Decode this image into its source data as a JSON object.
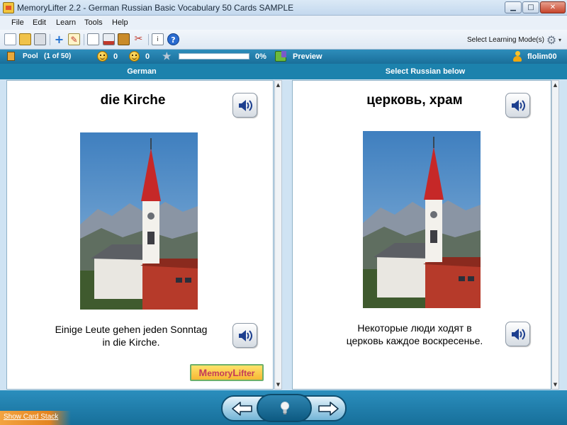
{
  "window": {
    "title": "MemoryLifter 2.2 - German Russian Basic Vocabulary 50 Cards SAMPLE",
    "min_glyph": "▁",
    "max_glyph": "□",
    "close_glyph": "✕"
  },
  "menu": [
    "File",
    "Edit",
    "Learn",
    "Tools",
    "Help"
  ],
  "toolbar": {
    "learning_mode_label": "Select Learning Mode(s)",
    "buttons": [
      "new-icon",
      "open-icon",
      "print-icon",
      "add-card-icon",
      "edit-icon",
      "presentation-icon",
      "statistics-icon",
      "archive-icon",
      "tools-icon",
      "info-icon",
      "help-icon"
    ]
  },
  "status": {
    "pool_label": "Pool",
    "pool_count": "(1 of 50)",
    "right_count": "0",
    "wrong_count": "0",
    "progress_value": 0,
    "progress_text": "0%",
    "preview_label": "Preview",
    "user_name": "flolim00"
  },
  "headers": {
    "left": "German",
    "right": "Select Russian below"
  },
  "card_left": {
    "word": "die Kirche",
    "sentence_line1": "Einige Leute gehen jeden Sonntag",
    "sentence_line2": "in die Kirche.",
    "picture": "church-with-red-spire"
  },
  "card_right": {
    "word": "церковь, храм",
    "sentence_line1": "Некоторые люди ходят в",
    "sentence_line2": "церковь каждое воскресенье.",
    "picture": "church-with-red-spire"
  },
  "logo": {
    "M": "M",
    "emory": "emory",
    "L": "L",
    "ifter": "ifter"
  },
  "bottom": {
    "show_stack_label": "Show Card Stack"
  },
  "colors": {
    "accent": "#1c82ad",
    "status_bar": "#1a6f9a",
    "progress_fill": "#3fb24f",
    "stack_tab": "#e38420"
  }
}
